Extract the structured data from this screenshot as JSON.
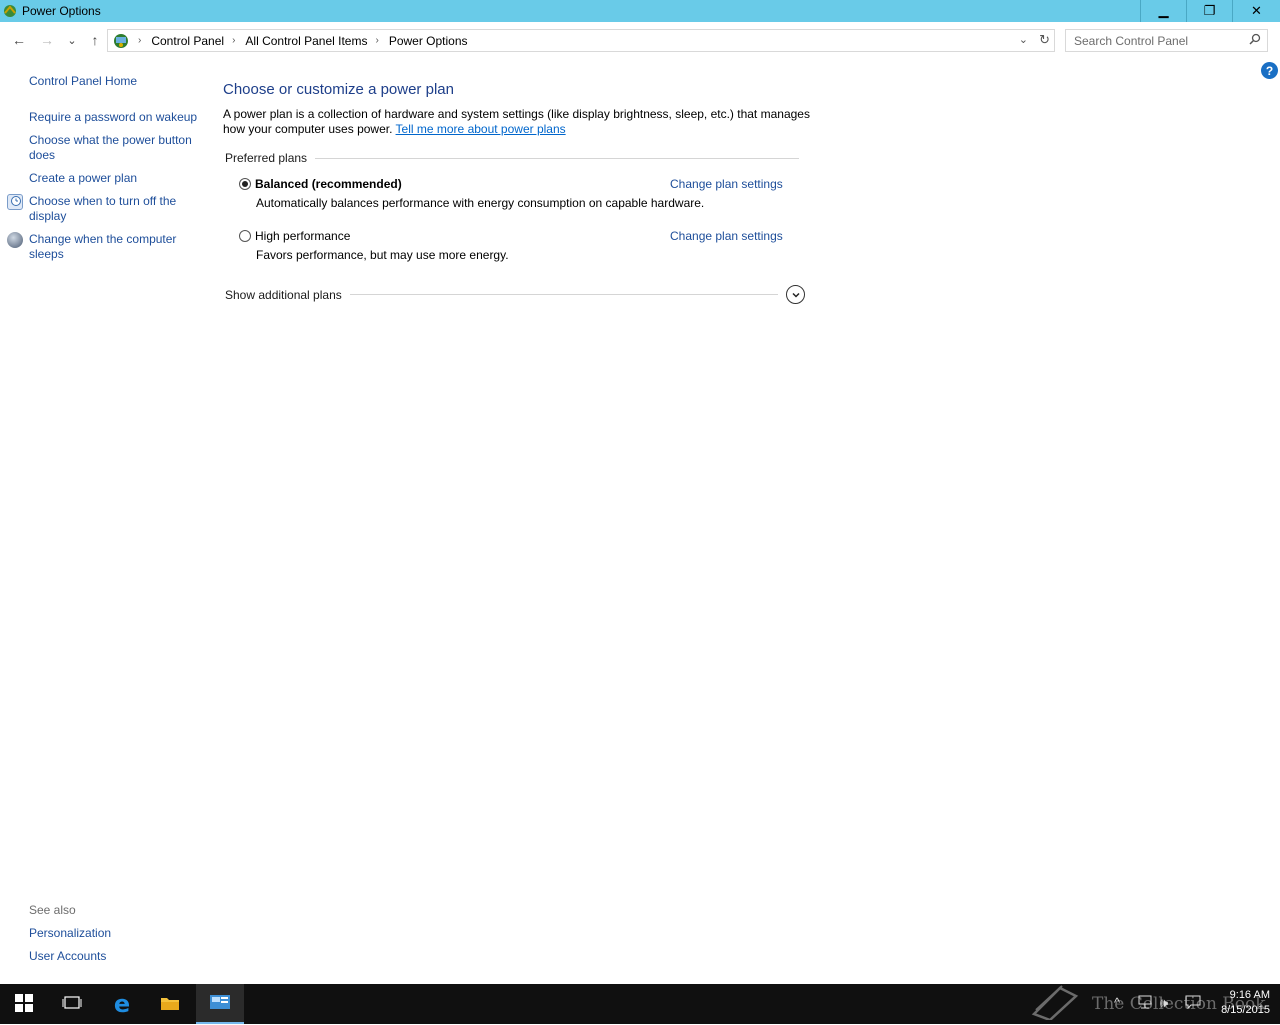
{
  "window": {
    "title": "Power Options",
    "controls": {
      "minimize": "▁",
      "maximize": "❐",
      "close": "✕"
    }
  },
  "nav": {
    "back": "←",
    "forward": "→",
    "recent": "⌄",
    "up": "↑",
    "breadcrumb": [
      "Control Panel",
      "All Control Panel Items",
      "Power Options"
    ],
    "search_placeholder": "Search Control Panel"
  },
  "help": "?",
  "sidebar": {
    "home": "Control Panel Home",
    "tasks": [
      {
        "label": "Require a password on wakeup",
        "icon": null
      },
      {
        "label": "Choose what the power button does",
        "icon": null
      },
      {
        "label": "Create a power plan",
        "icon": null
      },
      {
        "label": "Choose when to turn off the display",
        "icon": "display-timer-icon"
      },
      {
        "label": "Change when the computer sleeps",
        "icon": "sleep-moon-icon"
      }
    ],
    "see_also_title": "See also",
    "see_also": [
      "Personalization",
      "User Accounts"
    ]
  },
  "main": {
    "heading": "Choose or customize a power plan",
    "description": "A power plan is a collection of hardware and system settings (like display brightness, sleep, etc.) that manages how your computer uses power.",
    "learn_more": "Tell me more about power plans",
    "preferred_label": "Preferred plans",
    "plans": [
      {
        "name": "Balanced (recommended)",
        "desc": "Automatically balances performance with energy consumption on capable hardware.",
        "selected": true,
        "link": "Change plan settings"
      },
      {
        "name": "High performance",
        "desc": "Favors performance, but may use more energy.",
        "selected": false,
        "link": "Change plan settings"
      }
    ],
    "additional_label": "Show additional plans"
  },
  "taskbar": {
    "watermark": "The Collection Book",
    "time": "9:16 AM",
    "date": "8/15/2015",
    "accent": "#76b9ed"
  }
}
